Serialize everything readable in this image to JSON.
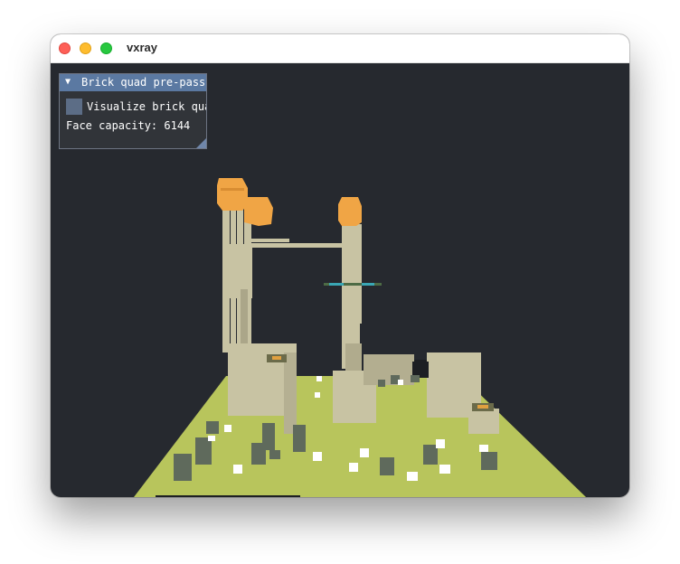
{
  "window": {
    "title": "vxray"
  },
  "panel": {
    "arrow": "▼",
    "title": "Brick quad pre-pass",
    "checkbox_label": "Visualize brick quads",
    "checkbox_checked": false,
    "face_capacity_text": "Face capacity: 6144"
  },
  "scene": {
    "background": "#26292f",
    "ground_color": "#b8c55c",
    "pillar_color": "#c8c3a3",
    "canopy_color": "#f0a545",
    "stone_color": "#5f6a5c",
    "flower_color": "#ffffff",
    "accent_color": "#3aa7b5"
  }
}
